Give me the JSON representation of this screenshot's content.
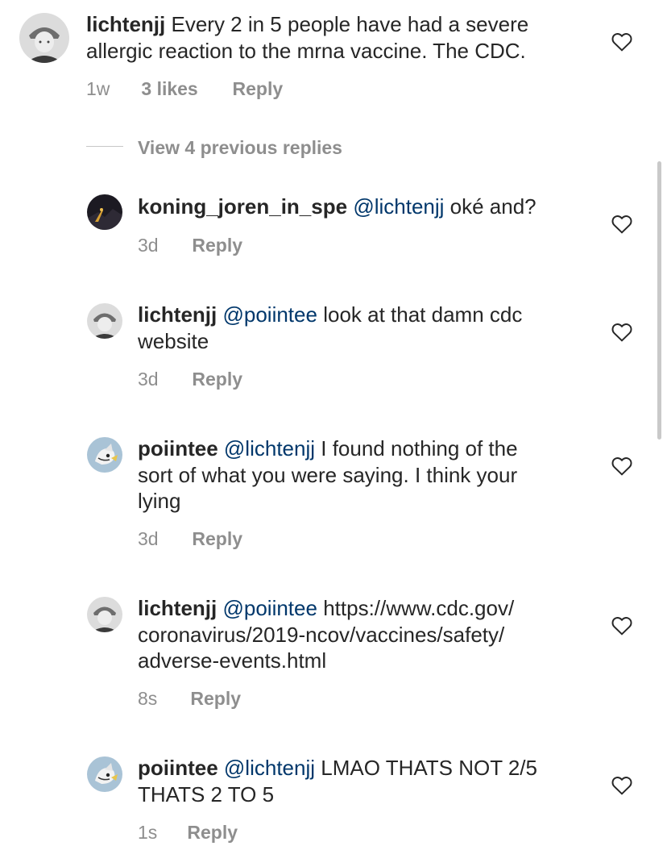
{
  "comments": [
    {
      "username": "lichtenjj",
      "mention": "",
      "lines": [
        "Every 2 in 5 people have had a severe",
        "allergic reaction to the mrna vaccine. The CDC."
      ],
      "time": "1w",
      "likes": "3 likes",
      "reply": "Reply",
      "avatar": "lichtenjj-avatar"
    },
    {
      "username": "koning_joren_in_spe",
      "mention": "@lichtenjj",
      "lines": [
        "oké and?"
      ],
      "time": "3d",
      "reply": "Reply",
      "avatar": "koning-avatar"
    },
    {
      "username": "lichtenjj",
      "mention": "@poiintee",
      "lines": [
        "look at that damn cdc",
        "website"
      ],
      "time": "3d",
      "reply": "Reply",
      "avatar": "lichtenjj-avatar"
    },
    {
      "username": "poiintee",
      "mention": "@lichtenjj",
      "lines": [
        "I found nothing of the",
        "sort of what you were saying. I think your",
        "lying"
      ],
      "time": "3d",
      "reply": "Reply",
      "avatar": "poiintee-avatar"
    },
    {
      "username": "lichtenjj",
      "mention": "@poiintee",
      "lines": [
        "https://www.cdc.gov/",
        "coronavirus/2019-ncov/vaccines/safety/",
        "adverse-events.html"
      ],
      "time": "8s",
      "reply": "Reply",
      "avatar": "lichtenjj-avatar"
    },
    {
      "username": "poiintee",
      "mention": "@lichtenjj",
      "lines": [
        "LMAO THATS NOT 2/5",
        "THATS 2 TO 5"
      ],
      "time": "1s",
      "reply": "Reply",
      "avatar": "poiintee-avatar"
    }
  ],
  "view_replies": "View 4 previous replies",
  "icons": {
    "like": "heart-icon"
  },
  "colors": {
    "text": "#262626",
    "muted": "#8e8e8e",
    "mention": "#00376b"
  }
}
